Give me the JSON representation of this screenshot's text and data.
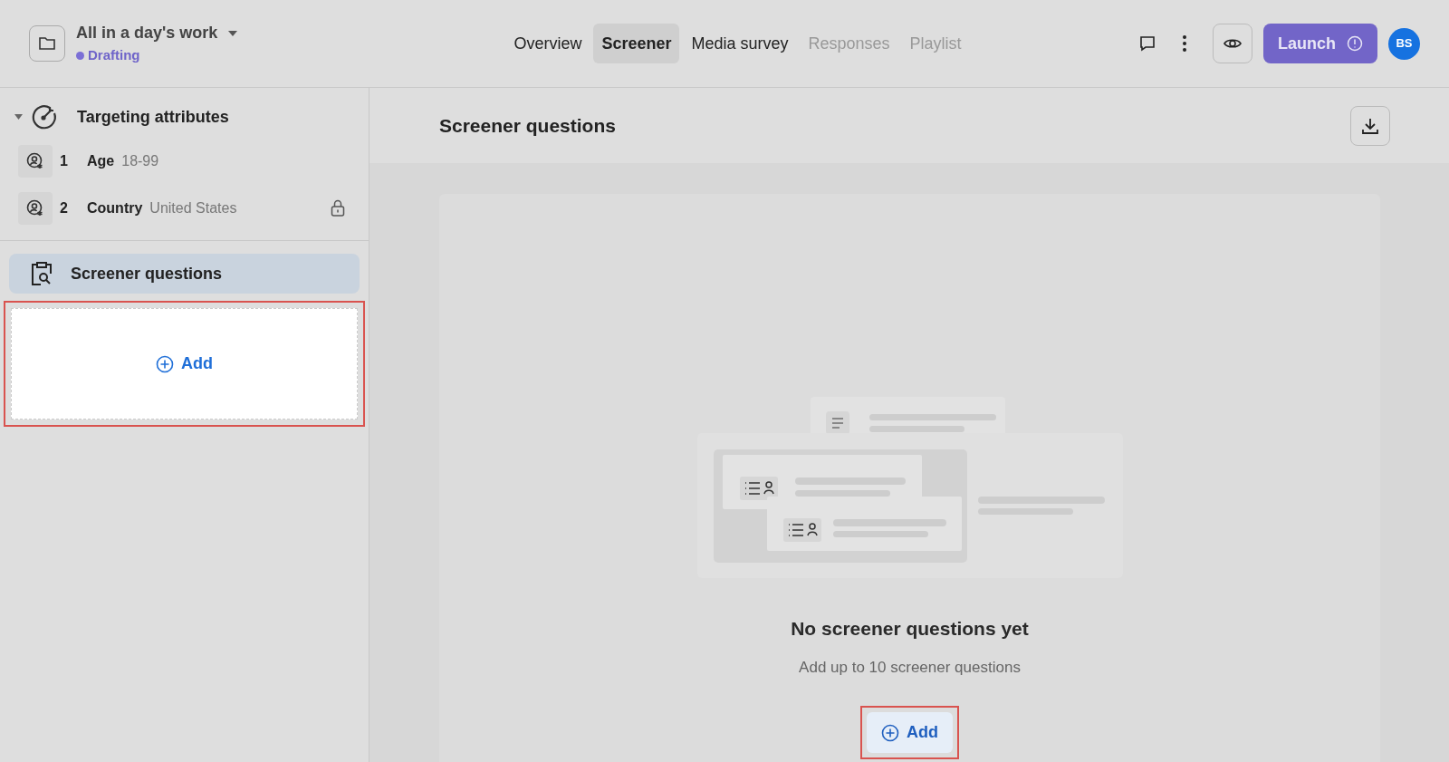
{
  "header": {
    "project_title": "All in a day's work",
    "status": "Drafting"
  },
  "tabs": [
    {
      "label": "Overview",
      "selected": false,
      "disabled": false
    },
    {
      "label": "Screener",
      "selected": true,
      "disabled": false
    },
    {
      "label": "Media survey",
      "selected": false,
      "disabled": false
    },
    {
      "label": "Responses",
      "selected": false,
      "disabled": true
    },
    {
      "label": "Playlist",
      "selected": false,
      "disabled": true
    }
  ],
  "launch_button": {
    "label": "Launch"
  },
  "avatar": {
    "initials": "BS"
  },
  "sidebar": {
    "targeting": {
      "title": "Targeting attributes",
      "expanded": true,
      "attributes": [
        {
          "number": "1",
          "name": "Age",
          "value": "18-99",
          "locked": false
        },
        {
          "number": "2",
          "name": "Country",
          "value": "United States",
          "locked": true
        }
      ]
    },
    "screener": {
      "label": "Screener questions",
      "selected": true
    },
    "add_button": {
      "label": "Add",
      "highlighted": true
    }
  },
  "main": {
    "title": "Screener questions",
    "empty_title": "No screener questions yet",
    "empty_subtitle": "Add up to 10 screener questions",
    "add_button": {
      "label": "Add",
      "highlighted": true
    }
  }
}
